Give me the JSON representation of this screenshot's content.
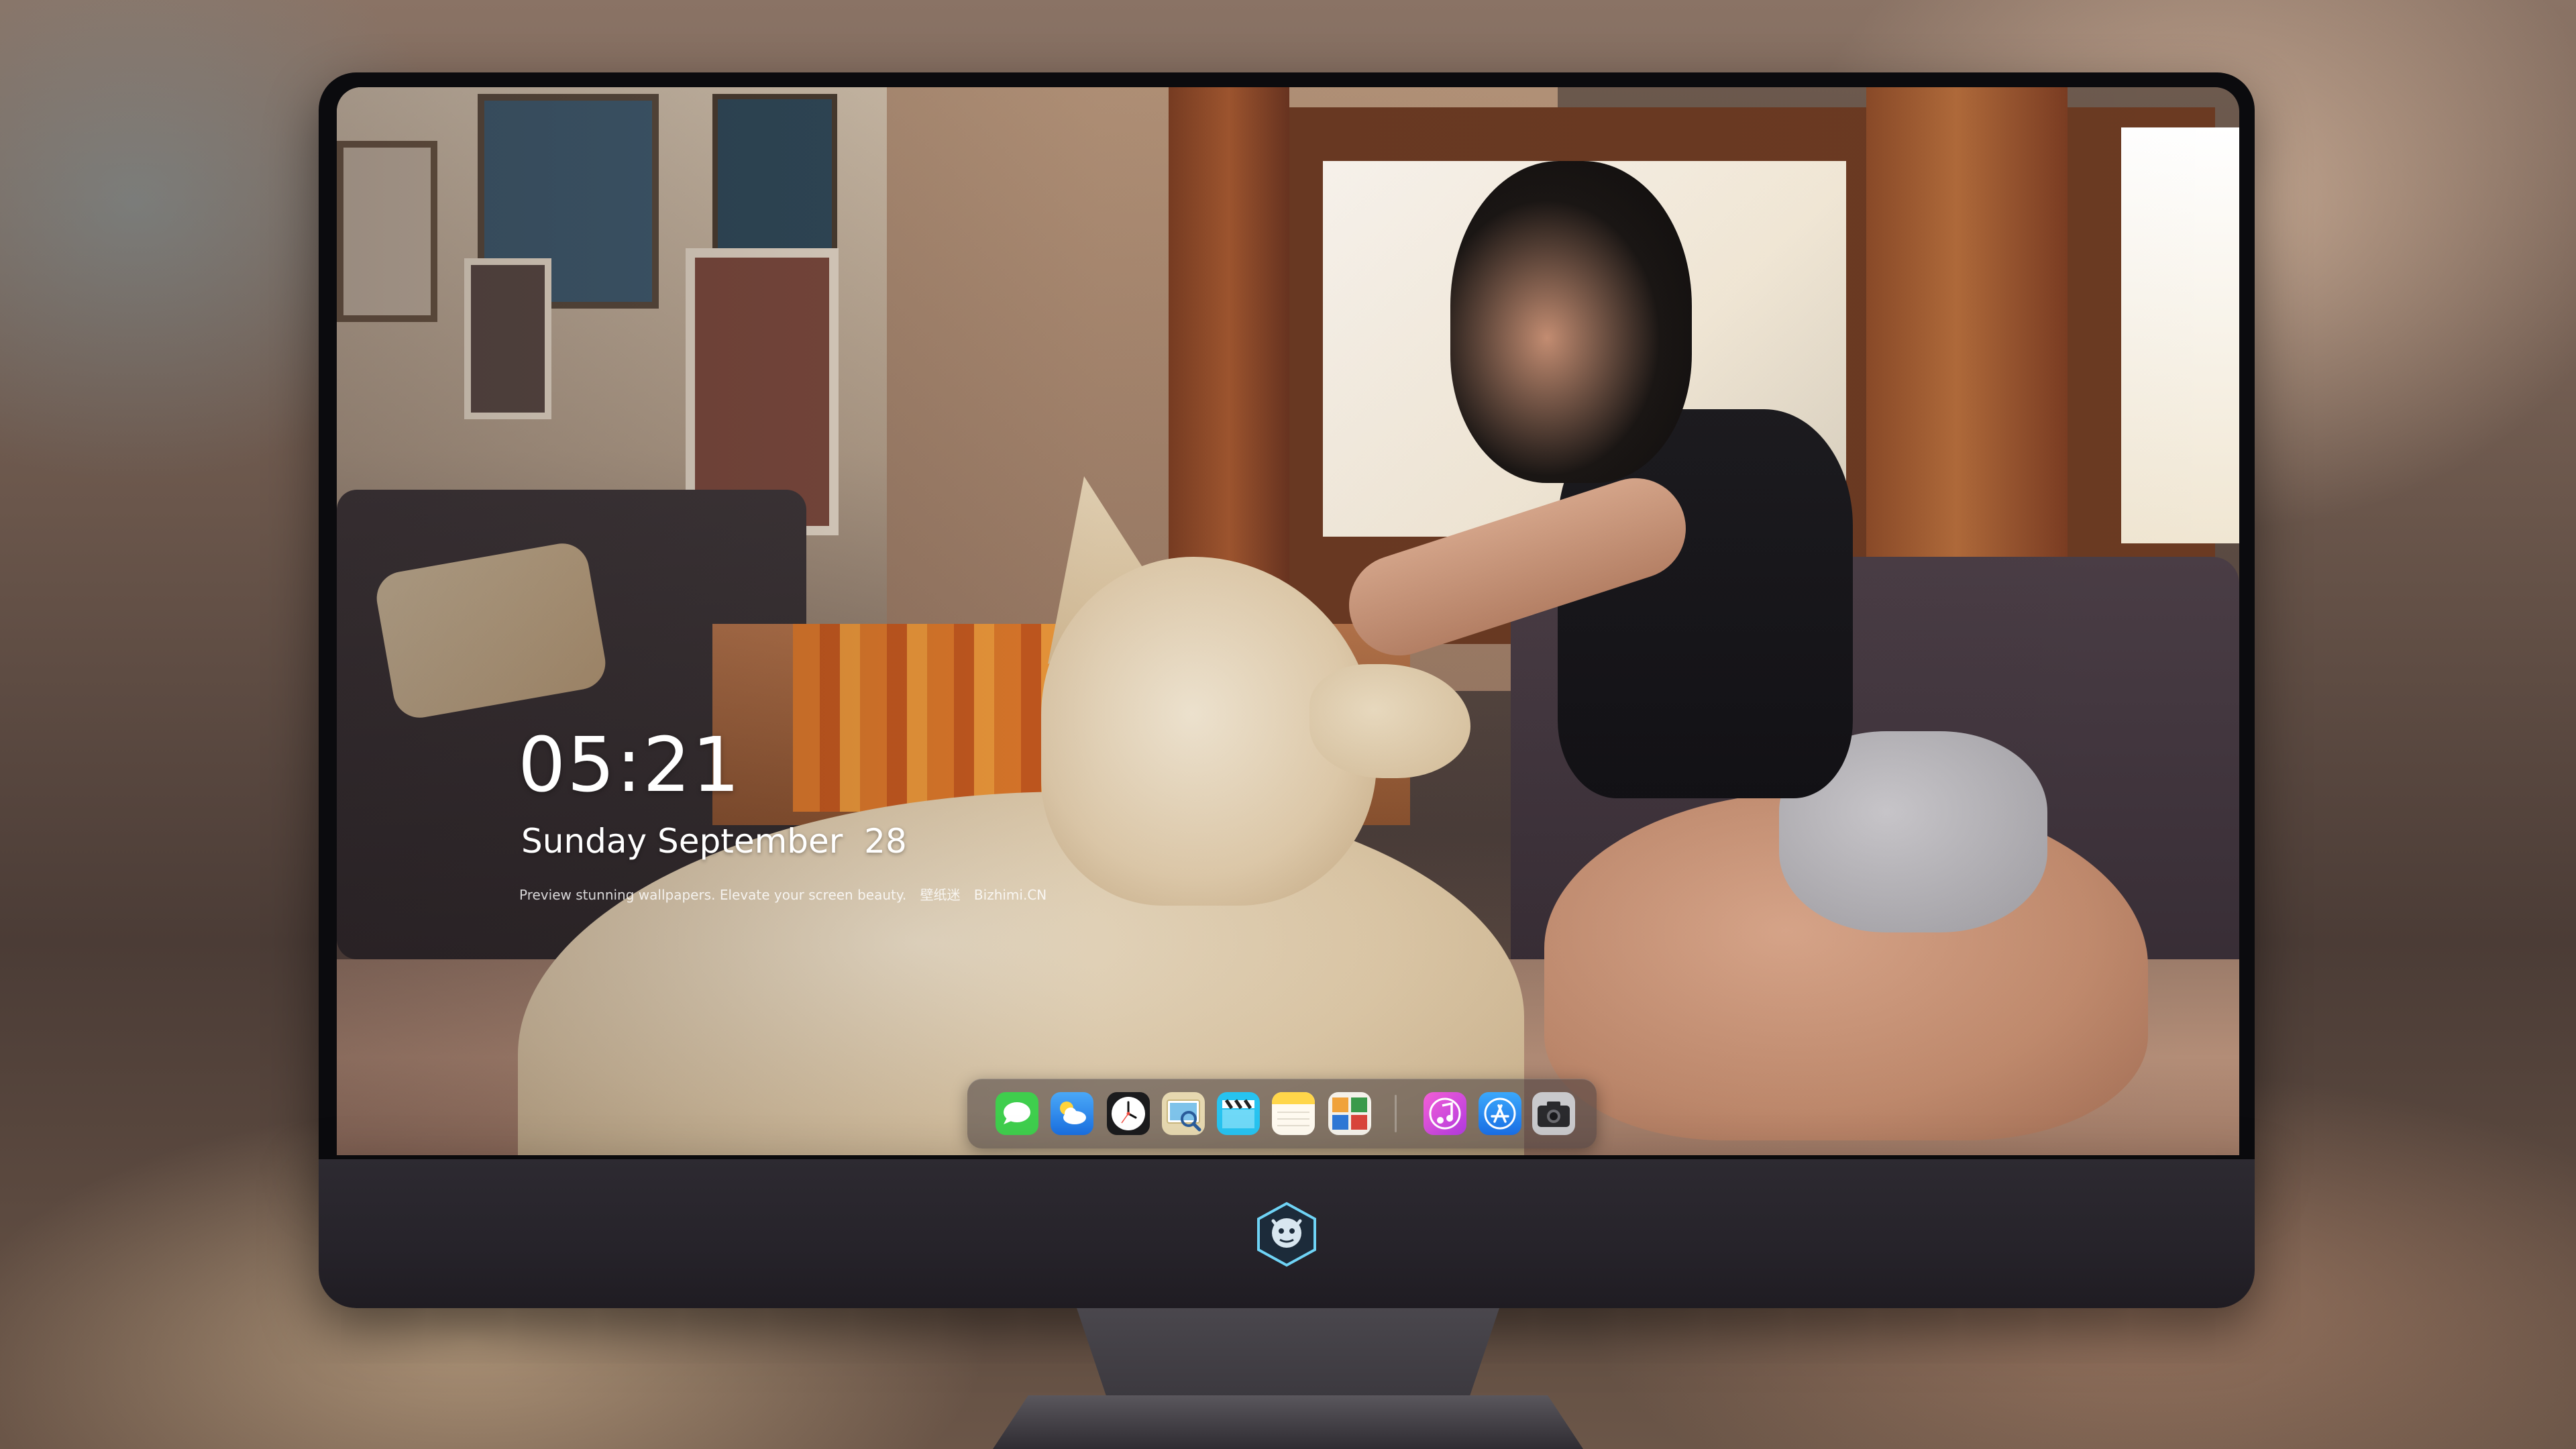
{
  "lock_screen": {
    "time": "05:21",
    "date": "Sunday September  28",
    "tagline": {
      "text": "Preview stunning wallpapers. Elevate your screen beauty.",
      "brand_cn": "壁纸迷",
      "brand_domain": "Bizhimi.CN"
    }
  },
  "dock": {
    "apps": [
      {
        "name": "Messages",
        "icon": "messages-icon"
      },
      {
        "name": "Weather",
        "icon": "weather-icon"
      },
      {
        "name": "Clock",
        "icon": "clock-icon"
      },
      {
        "name": "Preview",
        "icon": "preview-icon"
      },
      {
        "name": "Clips",
        "icon": "clapperboard-icon"
      },
      {
        "name": "Notes",
        "icon": "notes-icon"
      },
      {
        "name": "Photo Booth",
        "icon": "photo-booth-icon"
      }
    ],
    "pinned": [
      {
        "name": "Music",
        "icon": "music-icon"
      },
      {
        "name": "App Store",
        "icon": "app-store-icon"
      },
      {
        "name": "Camera",
        "icon": "camera-icon"
      }
    ]
  },
  "colors": {
    "messages_green": "#3fce4d",
    "weather_blue": "#2f8ff0",
    "music_pink": "#e741c4",
    "appstore_blue": "#1f8df5",
    "dock_background": "#463c3e"
  }
}
